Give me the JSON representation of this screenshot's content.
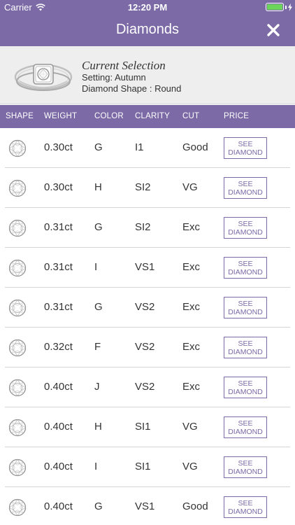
{
  "status_bar": {
    "carrier": "Carrier",
    "time": "12:20 PM",
    "battery_color": "#6cd65c"
  },
  "nav": {
    "title": "Diamonds",
    "close_icon": "close-icon"
  },
  "current_selection": {
    "title": "Current Selection",
    "setting": "Setting: Autumn",
    "shape": "Diamond Shape : Round"
  },
  "table": {
    "headers": {
      "shape": "SHAPE",
      "weight": "WEIGHT",
      "color": "COLOR",
      "clarity": "CLARITY",
      "cut": "CUT",
      "price": "PRICE"
    },
    "button_line1": "SEE",
    "button_line2": "DIAMOND",
    "rows": [
      {
        "weight": "0.30ct",
        "color": "G",
        "clarity": "I1",
        "cut": "Good"
      },
      {
        "weight": "0.30ct",
        "color": "H",
        "clarity": "SI2",
        "cut": "VG"
      },
      {
        "weight": "0.31ct",
        "color": "G",
        "clarity": "SI2",
        "cut": "Exc"
      },
      {
        "weight": "0.31ct",
        "color": "I",
        "clarity": "VS1",
        "cut": "Exc"
      },
      {
        "weight": "0.31ct",
        "color": "G",
        "clarity": "VS2",
        "cut": "Exc"
      },
      {
        "weight": "0.32ct",
        "color": "F",
        "clarity": "VS2",
        "cut": "Exc"
      },
      {
        "weight": "0.40ct",
        "color": "J",
        "clarity": "VS2",
        "cut": "Exc"
      },
      {
        "weight": "0.40ct",
        "color": "H",
        "clarity": "SI1",
        "cut": "VG"
      },
      {
        "weight": "0.40ct",
        "color": "I",
        "clarity": "SI1",
        "cut": "VG"
      },
      {
        "weight": "0.40ct",
        "color": "G",
        "clarity": "VS1",
        "cut": "Good"
      }
    ]
  },
  "colors": {
    "brand": "#7b6aa6"
  }
}
